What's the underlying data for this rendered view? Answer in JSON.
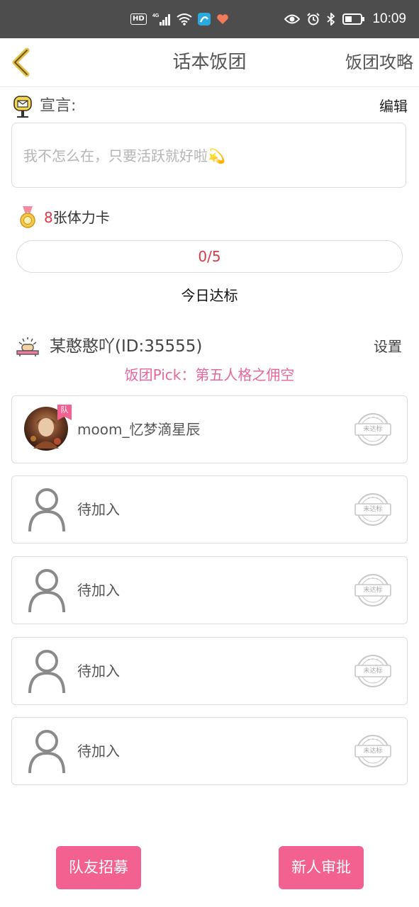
{
  "status_bar": {
    "time": "10:09",
    "network": "4G",
    "hd_badge": "HD"
  },
  "header": {
    "title": "话本饭团",
    "right_link": "饭团攻略"
  },
  "motto": {
    "label": "宣言:",
    "edit_label": "编辑",
    "text": "我不怎么在，只要活跃就好啦💫"
  },
  "stamina": {
    "count": "8",
    "suffix": "张体力卡",
    "progress_text": "0/5",
    "status_label": "今日达标"
  },
  "group": {
    "owner": "某憨憨吖(ID:35555)",
    "settings_label": "设置",
    "pick": "饭团Pick：第五人格之佣空"
  },
  "members": [
    {
      "name": "moom_忆梦滴星辰",
      "badge": "队",
      "stamp": "未达标",
      "has_avatar": true
    },
    {
      "name": "待加入",
      "stamp": "未达标",
      "has_avatar": false
    },
    {
      "name": "待加入",
      "stamp": "未达标",
      "has_avatar": false
    },
    {
      "name": "待加入",
      "stamp": "未达标",
      "has_avatar": false
    },
    {
      "name": "待加入",
      "stamp": "未达标",
      "has_avatar": false
    }
  ],
  "buttons": {
    "recruit": "队友招募",
    "approve": "新人审批"
  },
  "colors": {
    "accent_pink": "#f2618f",
    "pick_pink": "#e8679a",
    "progress_red": "#d93a48",
    "back_yellow": "#e6c24a"
  }
}
